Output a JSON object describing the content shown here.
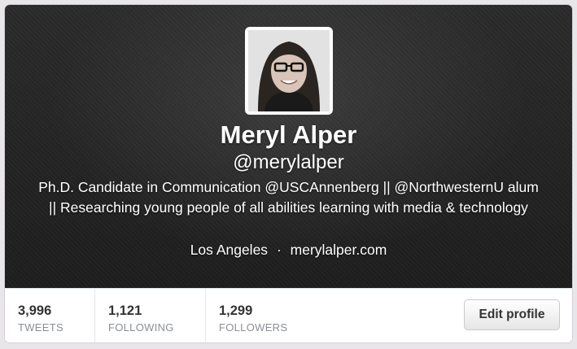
{
  "profile": {
    "name": "Meryl Alper",
    "handle": "@merylalper",
    "bio": "Ph.D. Candidate in Communication @USCAnnenberg || @NorthwesternU alum || Researching young people of all abilities learning with media & technology",
    "location": "Los Angeles",
    "separator": "·",
    "website": "merylalper.com"
  },
  "stats": [
    {
      "value": "3,996",
      "label": "TWEETS"
    },
    {
      "value": "1,121",
      "label": "FOLLOWING"
    },
    {
      "value": "1,299",
      "label": "FOLLOWERS"
    }
  ],
  "actions": {
    "edit_profile_label": "Edit profile"
  }
}
